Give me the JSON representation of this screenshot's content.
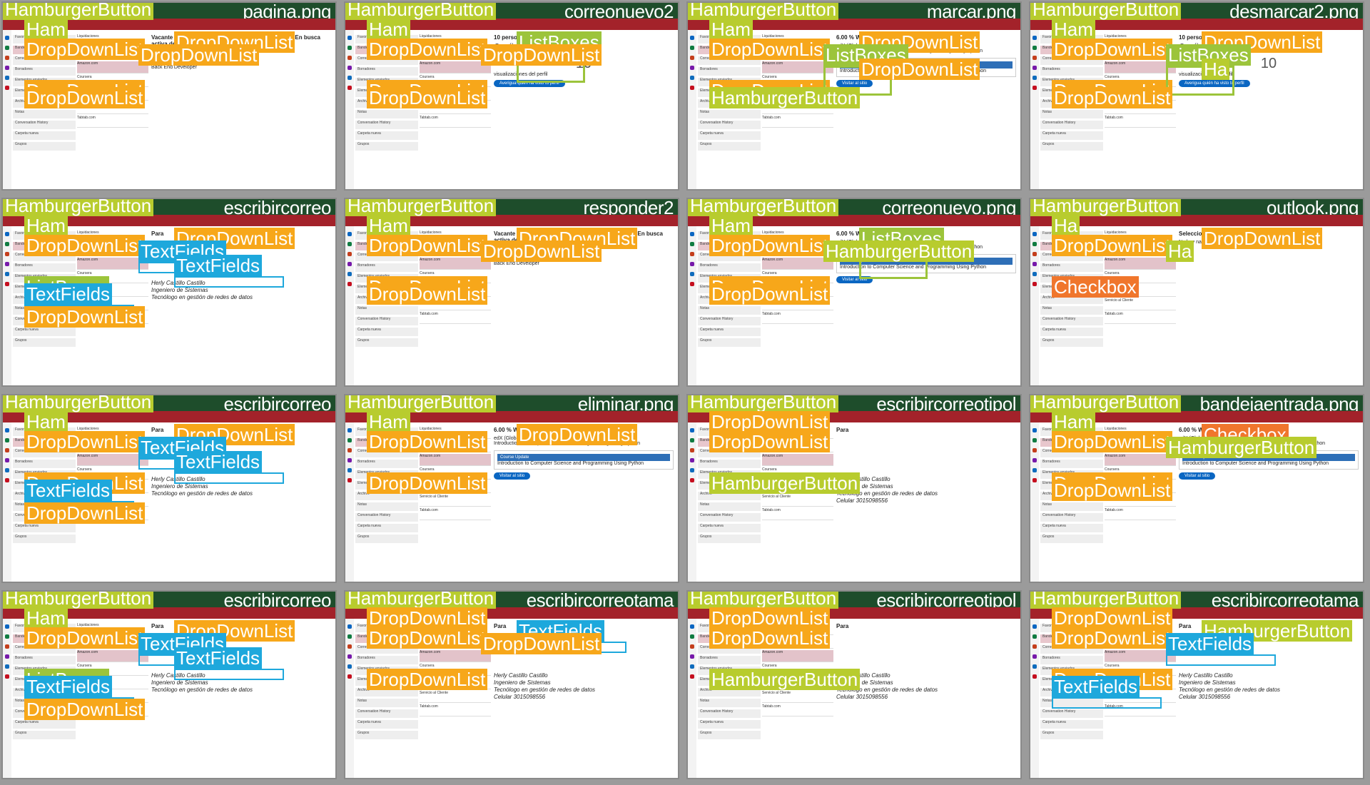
{
  "colors": {
    "hamburger": "#b8cc2e",
    "dropdown": "#f7a71a",
    "listboxes": "#9cc43b",
    "textfields": "#1ea8dc",
    "checkbox": "#f0762c",
    "titlebar": "#1e4d2b",
    "toolbar": "#a3222a"
  },
  "tiles": [
    {
      "filename": "pagina.png",
      "labels": [
        "HamburgerButton",
        "Ham",
        "DropDownList",
        "DropDownList",
        "DropDownList",
        "DropDownList",
        "DropDownList"
      ],
      "reading": {
        "headline": "Vacante de Backend Engineer (Remote) en Listopro: En busca activa de personal",
        "sender": "LinkedIn <jobs-listings@linkedin.com>",
        "body": "Principales empleos que te recomendamos",
        "job1": "Backend Engineer (Remote)",
        "job2": "Back End Developer"
      }
    },
    {
      "filename": "correonuevo2",
      "labels": [
        "HamburgerButton",
        "Ham",
        "DropDownList",
        "DropDownList",
        "ListBoxes",
        "DropDownList",
        "DropDownList"
      ],
      "reading": {
        "headline": "10 personas se han fijado en ti",
        "body": "¡Tu perfil está muy bien!",
        "count": "10",
        "count_label": "visualizaciones del perfil",
        "button": "Averigua quién ha visto tu perfil"
      }
    },
    {
      "filename": "marcar.png",
      "labels": [
        "HamburgerButton",
        "Ham",
        "DropDownList",
        "DropDownList",
        "DropDownList",
        "ListBoxes",
        "HamburgerButton",
        "DropDownList"
      ],
      "reading": {
        "headline": "6.00 % Welcome!",
        "sender": "edX (Global)",
        "body": "Introduction to Computer Science and Programming Using Python",
        "card_head": "Course Update",
        "card_title": "Introduction to Computer Science and Programming Using Python",
        "button": "Visitar al sitio"
      }
    },
    {
      "filename": "desmarcar2.png",
      "labels": [
        "HamburgerButton",
        "Ham",
        "DropDownList",
        "DropDownList",
        "DropDownList",
        "ListBoxes",
        "DropDownList",
        "Ha"
      ],
      "reading": {
        "headline": "10 personas se han fijado en ti",
        "body": "¡Tu perfil está muy bien!",
        "count": "10",
        "count_label": "visualizaciones del perfil",
        "button": "Averigua quién ha visto tu perfil"
      }
    },
    {
      "filename": "escribircorreo",
      "labels": [
        "HamburgerButton",
        "Ham",
        "DropDownList",
        "ListBoxes",
        "DropDownList",
        "TextFields",
        "TextFields",
        "TextFields",
        "DropDownList"
      ],
      "reading": {
        "headline": "Para",
        "sig1": "Herly Castillo Castillo",
        "sig2": "Ingeniero de Sistemas",
        "sig3": "Tecnólogo en gestión de redes de datos"
      }
    },
    {
      "filename": "responder2",
      "labels": [
        "HamburgerButton",
        "Ham",
        "DropDownList",
        "DropDownList",
        "DropDownList",
        "DropDownList",
        "DropDownList"
      ],
      "reading": {
        "headline": "Vacante de Backend Engineer (Remote) en Listopro: En busca activa de personal",
        "sender": "LinkedIn <jobs-listings@linkedin.com>",
        "body": "Principales empleos que te recomendamos",
        "job1": "Backend Engineer (Remote)",
        "job2": "Back End Developer"
      }
    },
    {
      "filename": "correonuevo.png",
      "labels": [
        "HamburgerButton",
        "Ham",
        "DropDownList",
        "DropDownList",
        "ListBoxes",
        "HamburgerButton",
        "DropDownList"
      ],
      "reading": {
        "headline": "6.00 % Welcome!",
        "sender": "edX (Global)",
        "body": "Introduction to Computer Science and Programming Using Python",
        "card_head": "Course Update",
        "card_title": "Introduction to Computer Science and Programming Using Python",
        "button": "Visitar al sitio"
      }
    },
    {
      "filename": "outlook.png",
      "labels": [
        "HamburgerButton",
        "Ha",
        "DropDownList",
        "Checkbox",
        "DropDownList",
        "Ha"
      ],
      "reading": {
        "headline": "Seleccionar un elemento para leerlo",
        "body": "No hay nada seleccionado"
      }
    },
    {
      "filename": "escribircorreo",
      "labels": [
        "HamburgerButton",
        "Ham",
        "DropDownList",
        "DropDownList",
        "DropDownList",
        "TextFields",
        "TextFields",
        "TextFields",
        "DropDownList"
      ],
      "reading": {
        "headline": "Para",
        "sig1": "Herly Castillo Castillo",
        "sig2": "Ingeniero de Sistemas",
        "sig3": "Tecnólogo en gestión de redes de datos"
      }
    },
    {
      "filename": "eliminar.png",
      "labels": [
        "HamburgerButton",
        "Ham",
        "DropDownList",
        "DropDownList",
        "DropDownList"
      ],
      "reading": {
        "headline": "6.00 % Welcome!",
        "sender": "edX (Global)",
        "body": "Introduction to Computer Science and Programming Using Python",
        "card_head": "Course Update",
        "card_title": "Introduction to Computer Science and Programming Using Python",
        "button": "Visitar al sitio"
      }
    },
    {
      "filename": "escribircorreotipol",
      "labels": [
        "HamburgerButton",
        "DropDownList",
        "DropDownList",
        "HamburgerButton"
      ],
      "reading": {
        "headline": "Para",
        "sig1": "Herly Castillo Castillo",
        "sig2": "Ingeniero de Sistemas",
        "sig3": "Tecnólogo en gestión de redes de datos",
        "sig4": "Celular 3015098556"
      }
    },
    {
      "filename": "bandejaentrada.png",
      "labels": [
        "HamburgerButton",
        "Ham",
        "DropDownList",
        "DropDownList",
        "Checkbox",
        "HamburgerButton",
        "DropDownList"
      ],
      "reading": {
        "headline": "6.00 % Welcome!",
        "sender": "edX (Global)",
        "body": "Introduction to Computer Science and Programming Using Python",
        "card_head": "Course Update",
        "card_title": "Introduction to Computer Science and Programming Using Python",
        "button": "Visitar al sitio"
      }
    },
    {
      "filename": "escribircorreo",
      "labels": [
        "HamburgerButton",
        "Ham",
        "DropDownList",
        "ListBoxes",
        "DropDownList",
        "TextFields",
        "TextFields",
        "TextFields",
        "DropDownList"
      ],
      "reading": {
        "headline": "Para",
        "sig1": "Herly Castillo Castillo",
        "sig2": "Ingeniero de Sistemas",
        "sig3": "Tecnólogo en gestión de redes de datos"
      }
    },
    {
      "filename": "escribircorreotama",
      "labels": [
        "HamburgerButton",
        "DropDownList",
        "DropDownList",
        "DropDownList",
        "TextFields",
        "DropDownList"
      ],
      "reading": {
        "headline": "Para",
        "sig1": "Herly Castillo Castillo",
        "sig2": "Ingeniero de Sistemas",
        "sig3": "Tecnólogo en gestión de redes de datos",
        "sig4": "Celular 3015098556"
      }
    },
    {
      "filename": "escribircorreotipol",
      "labels": [
        "HamburgerButton",
        "DropDownList",
        "DropDownList",
        "HamburgerButton"
      ],
      "reading": {
        "headline": "Para",
        "sig1": "Herly Castillo Castillo",
        "sig2": "Ingeniero de Sistemas",
        "sig3": "Tecnólogo en gestión de redes de datos",
        "sig4": "Celular 3015098556"
      }
    },
    {
      "filename": "escribircorreotama",
      "labels": [
        "HamburgerButton",
        "DropDownList",
        "DropDownList",
        "DropDownList",
        "HamburgerButton",
        "TextFields",
        "TextFields"
      ],
      "reading": {
        "headline": "Para",
        "sig1": "Herly Castillo Castillo",
        "sig2": "Ingeniero de Sistemas",
        "sig3": "Tecnólogo en gestión de redes de datos",
        "sig4": "Celular 3015098556"
      }
    }
  ],
  "folder_labels": [
    "Favoritos",
    "Bandeja de entrada",
    "Correo no deseado",
    "Borradores",
    "Elementos enviados",
    "Elementos eliminados",
    "Archivo",
    "Notas",
    "Conversation History",
    "Carpeta nueva",
    "Grupos"
  ],
  "message_senders": [
    "Liquidaciones",
    "LinkedIn",
    "Amazon.com",
    "Coursera",
    "edX (Global)",
    "Servicio al Cliente",
    "Tabtab.com"
  ]
}
